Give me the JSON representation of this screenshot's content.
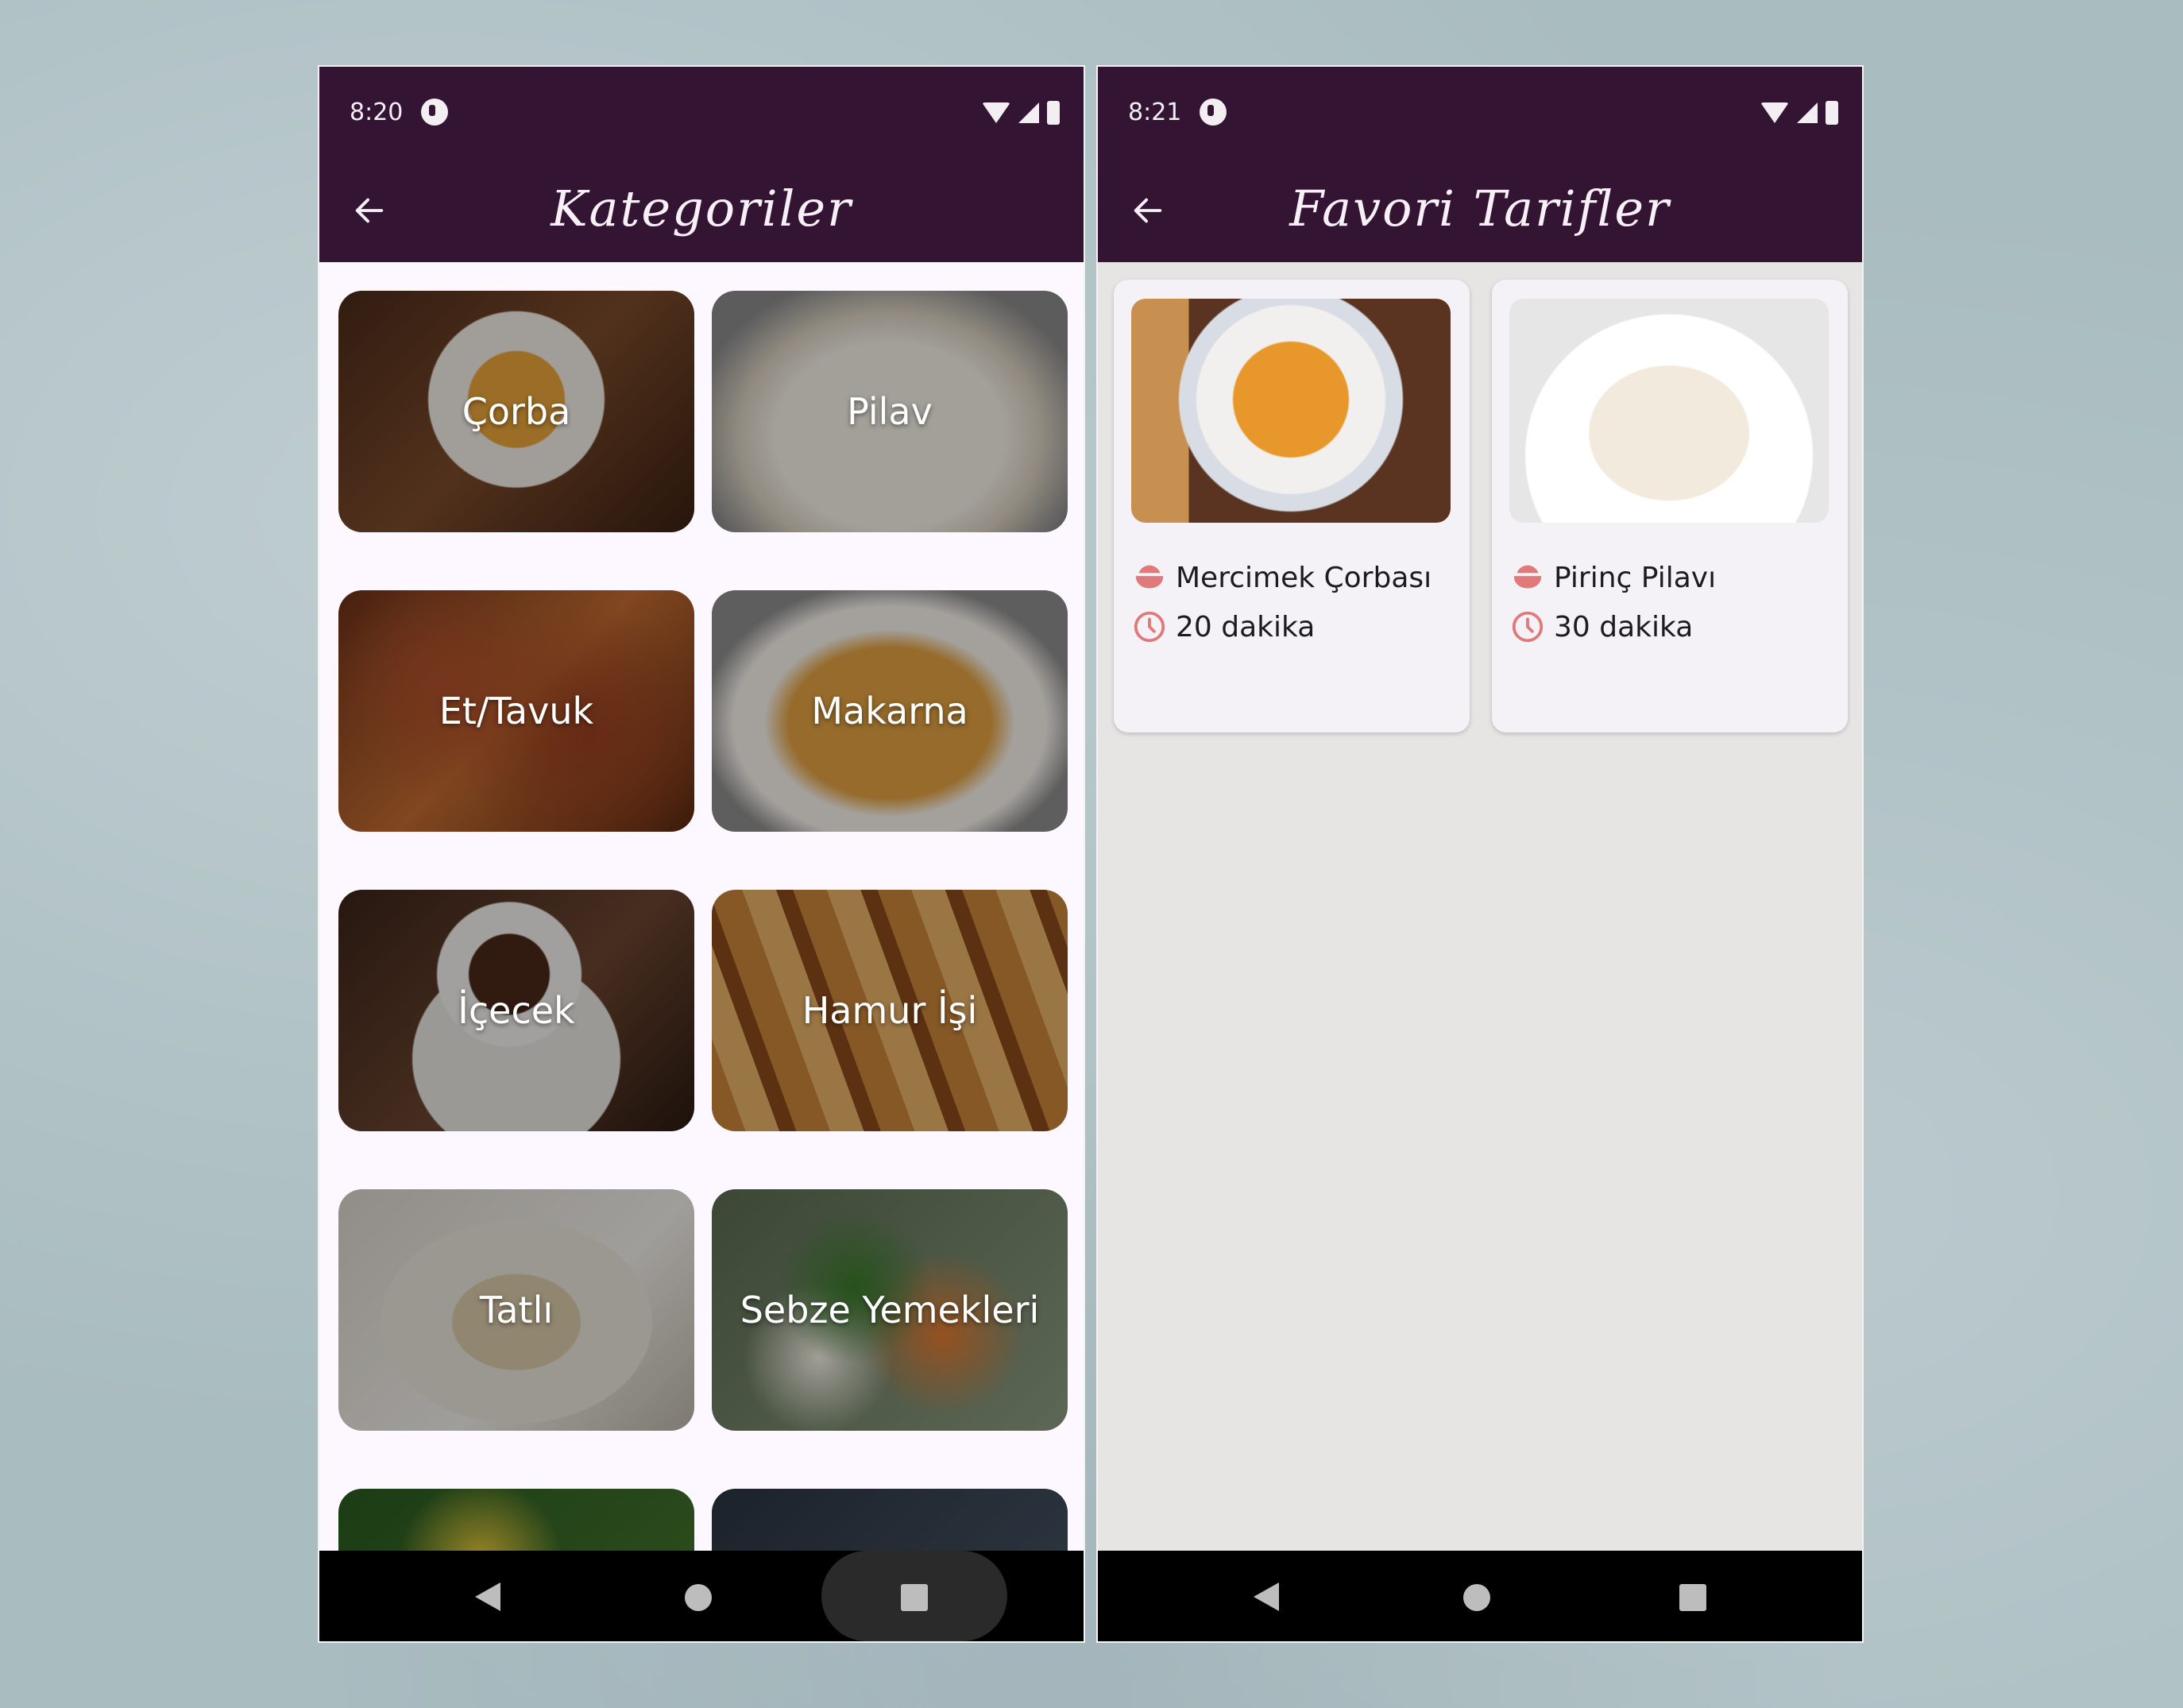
{
  "colors": {
    "appbar": "#331433",
    "accent_icon": "#e07a7a",
    "screen_bg_left": "#fdf7ff",
    "screen_bg_right": "#e7e5e4"
  },
  "left_screen": {
    "status_time": "8:20",
    "title": "Kategoriler",
    "categories": [
      {
        "label": "Çorba"
      },
      {
        "label": "Pilav"
      },
      {
        "label": "Et/Tavuk"
      },
      {
        "label": "Makarna"
      },
      {
        "label": "İçecek"
      },
      {
        "label": "Hamur İşi"
      },
      {
        "label": "Tatlı"
      },
      {
        "label": "Sebze Yemekleri"
      }
    ]
  },
  "right_screen": {
    "status_time": "8:21",
    "title": "Favori Tarifler",
    "favorites": [
      {
        "name": "Mercimek Çorbası",
        "duration": "20 dakika"
      },
      {
        "name": "Pirinç Pilavı",
        "duration": "30 dakika"
      }
    ]
  },
  "icons": [
    "back-arrow-icon",
    "wifi-icon",
    "signal-icon",
    "battery-icon",
    "bowl-icon",
    "clock-icon",
    "nav-back-icon",
    "nav-home-icon",
    "nav-recents-icon"
  ]
}
